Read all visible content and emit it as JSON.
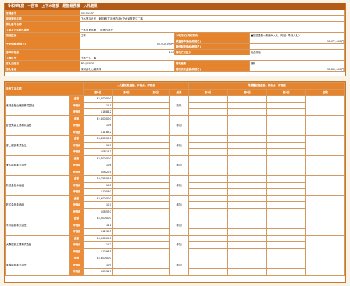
{
  "header": {
    "title": "令和4年度　一宮市　上下水道部　経営総務課　入札結果"
  },
  "info": {
    "management_no_label": "管理番号",
    "management_no": "50371307",
    "case_name_label": "調達案件名称",
    "case_name": "下水第307号　東部第7丁目地内ほか下水道管更生工事",
    "case_no_label": "開札番号名称",
    "place_label": "工事または納入場所",
    "place": "一宮市東部第7丁目地内ほか",
    "category_label": "調達区分",
    "category": "工事",
    "method_label": "入札方式(契約方式)",
    "method": "■容量重型一般競争入札（方法：電子入札）",
    "planned_price_label": "予定価格(税抜き)",
    "planned_price": "34,400,000円",
    "base_price_label": "調査基準価格(税抜き)",
    "base_price": "30,477,000円",
    "min_price_label": "最低制限価格(税抜き)",
    "base_score_label": "基準評価値",
    "base_score": "100",
    "decision_method_label": "落札方式区分",
    "decision_method": "総合評価",
    "work_category_label": "工種区分",
    "work_category": "土木一式工事",
    "decision_date_label": "落札決定日",
    "decision_date": "R04/05/30",
    "bidder_name_label": "落札者名",
    "bidder_name": "東浦金杜山繊設株",
    "decision_flag_label": "落札種類",
    "decision_flag": "落札",
    "winning_amount_label": "落札決定金額(税抜き)",
    "winning_amount": "32,600,000円"
  },
  "results": {
    "company_header": "商号又は名称",
    "bid_header": "入札書記載金額、評価点、評価値",
    "quote_header": "見積書記載金額、評価点、評価値",
    "round1": "第1回",
    "round2": "第2回",
    "round3": "第3回",
    "result": "結果",
    "row_labels": {
      "amount": "金額",
      "score": "評価点",
      "value": "評価値"
    },
    "companies": [
      {
        "name": "東浦金杜山繊設株式会社",
        "amount": "32,600,000",
        "score": "111",
        "value": "116.842",
        "result": "落札"
      },
      {
        "name": "倉田鬼井工業株式会社",
        "amount": "32,600,000",
        "score": "106",
        "value": "111.852",
        "result": "参加"
      },
      {
        "name": "富士建設株式会社",
        "amount": "33,400,000",
        "score": "105",
        "value": "108.143",
        "result": "参加"
      },
      {
        "name": "東住建設株式会社",
        "amount": "33,700,000",
        "score": "106",
        "value": "108.205",
        "result": "参加"
      },
      {
        "name": "株式会社水谷組",
        "amount": "33,750,000",
        "score": "108",
        "value": "110.080",
        "result": "参加"
      },
      {
        "name": "株式会社寺西組",
        "amount": "33,900,000",
        "score": "107",
        "value": "108.570",
        "result": "参加"
      },
      {
        "name": "市川建設株式会社",
        "amount": "34,000,000",
        "score": "111",
        "value": "112.305",
        "result": "参加"
      },
      {
        "name": "大野建設工業株式会社",
        "amount": "34,100,000",
        "score": "112",
        "value": "112.985",
        "result": "参加"
      },
      {
        "name": "豊橋建設株式会社",
        "amount": "34,300,000",
        "score": "109",
        "value": "109.317",
        "result": "参加"
      }
    ]
  }
}
